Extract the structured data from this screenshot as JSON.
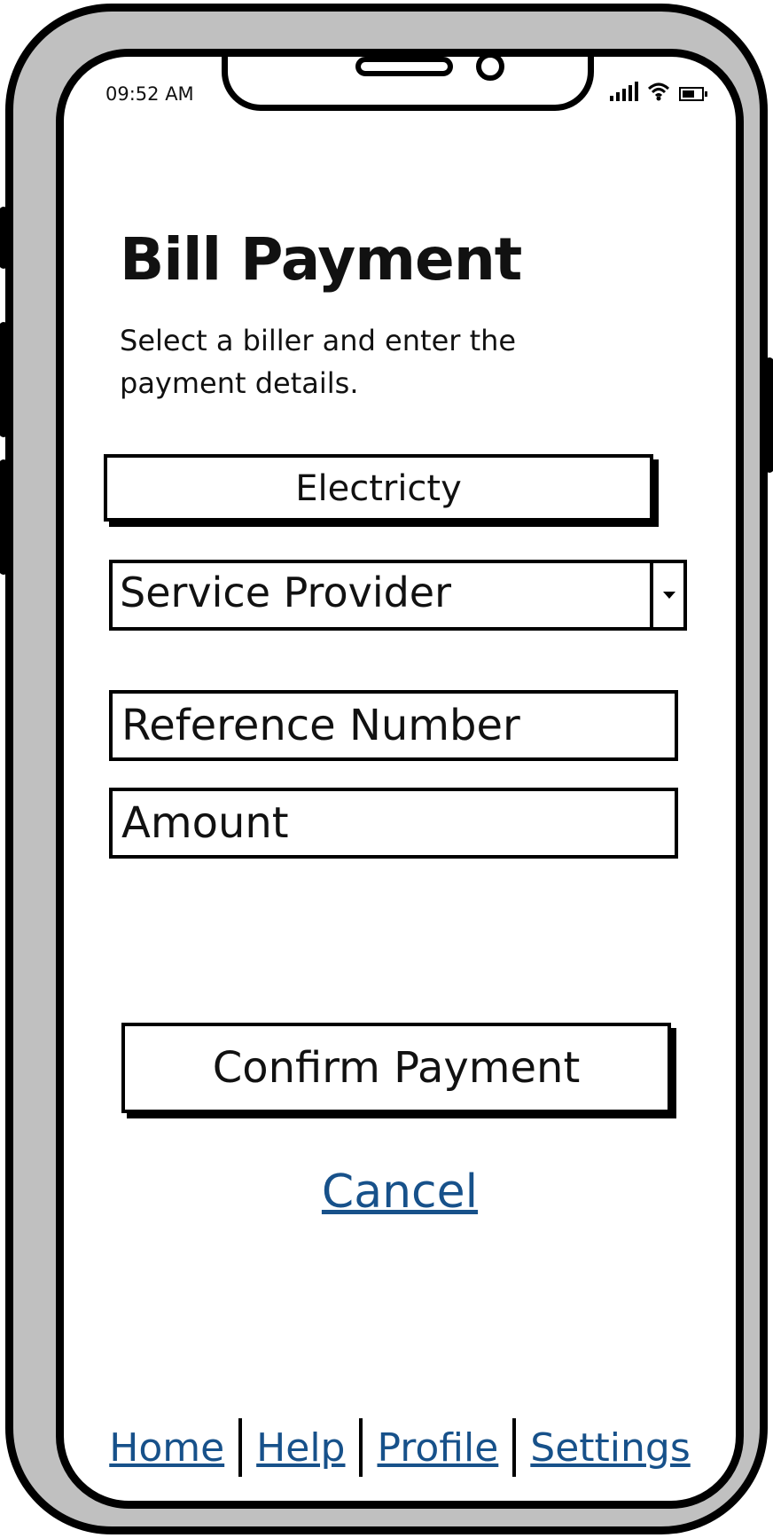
{
  "status_bar": {
    "time": "09:52 AM",
    "icons": [
      "signal-icon",
      "wifi-icon",
      "battery-icon"
    ]
  },
  "page": {
    "title": "Bill Payment",
    "subtitle": "Select a biller and enter the payment details."
  },
  "form": {
    "category": "Electricty",
    "provider_select": {
      "value": "Service Provider"
    },
    "reference_field": {
      "value": "Reference Number"
    },
    "amount_field": {
      "value": "Amount"
    },
    "confirm_label": "Confirm Payment",
    "cancel_label": "Cancel"
  },
  "nav": {
    "items": [
      "Home",
      "Help",
      "Profile",
      "Settings"
    ]
  },
  "colors": {
    "link": "#17518a",
    "frame": "#c0c0c0",
    "ink": "#000000"
  }
}
